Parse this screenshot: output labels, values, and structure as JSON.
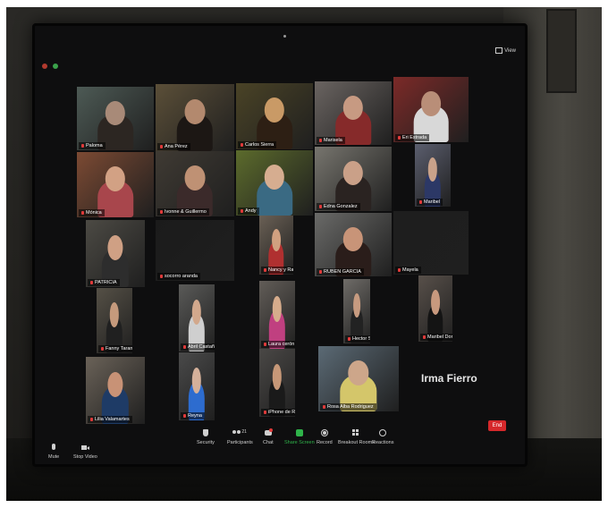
{
  "window": {
    "view_label": "View"
  },
  "participants": [
    {
      "name": "Paloma"
    },
    {
      "name": "Ana Pérez"
    },
    {
      "name": "Carlos Sierra"
    },
    {
      "name": "Marisela"
    },
    {
      "name": "Eri Estrada"
    },
    {
      "name": "Mónica"
    },
    {
      "name": "Ivonne & Guillermo"
    },
    {
      "name": "Andy"
    },
    {
      "name": "Edna Gonzalez"
    },
    {
      "name": "Maribel"
    },
    {
      "name": "PATRICIA"
    },
    {
      "name": "socorro aranda"
    },
    {
      "name": "Nancy y Rafael"
    },
    {
      "name": "RUBEN GARCIA"
    },
    {
      "name": "Mayela"
    },
    {
      "name": "Fanny Tarango"
    },
    {
      "name": "Abril Castañeda"
    },
    {
      "name": "Laura cerón"
    },
    {
      "name": "Hector San Martin"
    },
    {
      "name": "Maribel Domínguez"
    },
    {
      "name": "Lilia Valamartes"
    },
    {
      "name": "Reyna"
    },
    {
      "name": "iPhone de Rosaura"
    },
    {
      "name": "Rosa Alba Rodriguez"
    },
    {
      "name": "Irma Fierro"
    }
  ],
  "toolbar": {
    "mute": "Mute",
    "stop_video": "Stop Video",
    "security": "Security",
    "participants": "Participants",
    "participants_count": "21",
    "chat": "Chat",
    "share_screen": "Share Screen",
    "record": "Record",
    "breakout_rooms": "Breakout Rooms",
    "reactions": "Reactions",
    "end": "End"
  },
  "colors": {
    "end_red": "#d6282b",
    "share_green": "#2fb34a",
    "mic_red": "#e03a3a"
  }
}
